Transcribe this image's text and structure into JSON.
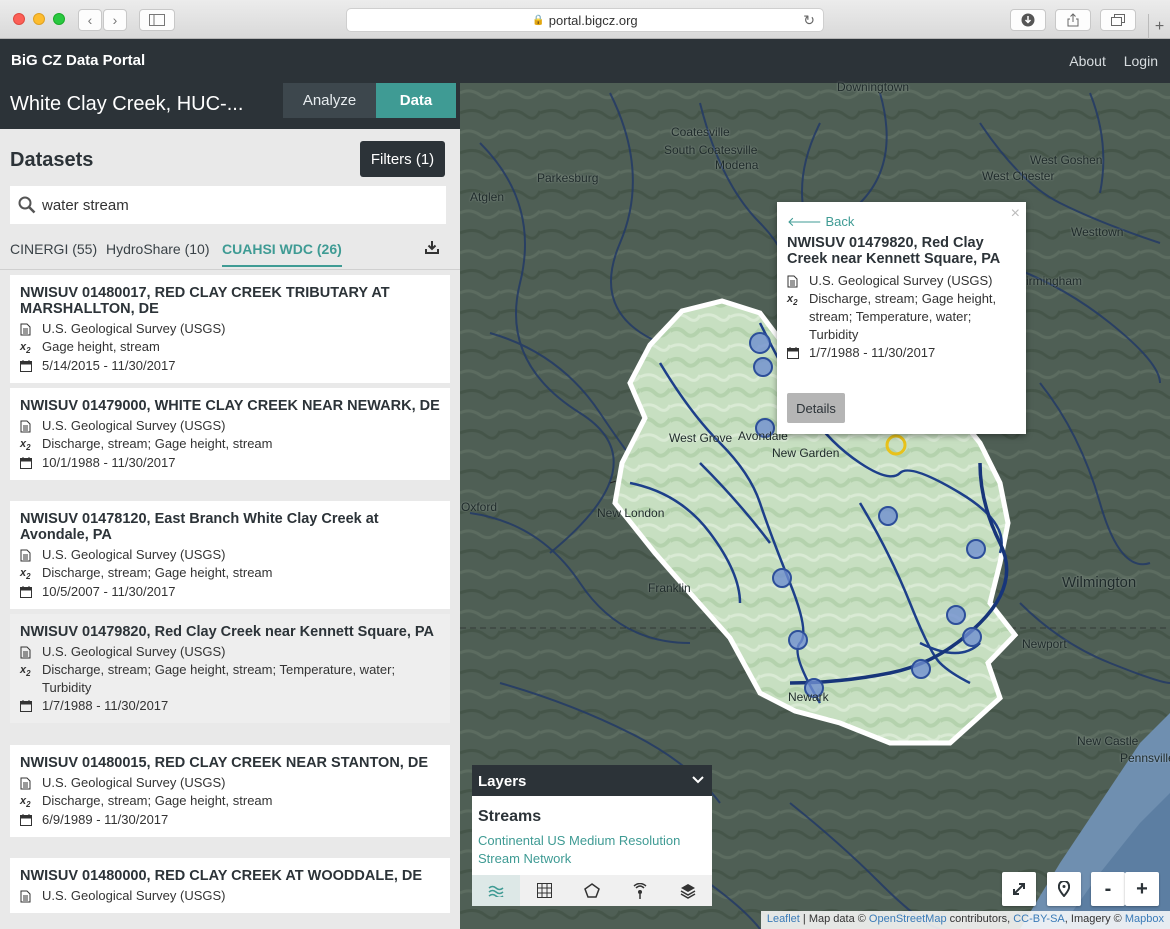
{
  "browser": {
    "url": "portal.bigcz.org"
  },
  "app": {
    "brand": "BiG CZ Data Portal",
    "nav": [
      "About",
      "Login"
    ]
  },
  "sidebar": {
    "area_title": "White Clay Creek, HUC-...",
    "tabs": {
      "analyze": "Analyze",
      "data": "Data"
    },
    "datasets_title": "Datasets",
    "filters_label": "Filters (1)",
    "search_value": "water stream",
    "sources": [
      {
        "label": "CINERGI (55)",
        "active": false
      },
      {
        "label": "HydroShare (10)",
        "active": false
      },
      {
        "label": "CUAHSI WDC (26)",
        "active": true
      }
    ],
    "results": [
      {
        "title": "NWISUV 01480017, RED CLAY CREEK TRIBUTARY AT MARSHALLTON, DE",
        "source": "U.S. Geological Survey (USGS)",
        "variables": "Gage height, stream",
        "dates": "5/14/2015 - 11/30/2017",
        "selected": false
      },
      {
        "title": "NWISUV 01479000, WHITE CLAY CREEK NEAR NEWARK, DE",
        "source": "U.S. Geological Survey (USGS)",
        "variables": "Discharge, stream; Gage height, stream",
        "dates": "10/1/1988 - 11/30/2017",
        "selected": false
      },
      {
        "title": "NWISUV 01478120, East Branch White Clay Creek at Avondale, PA",
        "source": "U.S. Geological Survey (USGS)",
        "variables": "Discharge, stream; Gage height, stream",
        "dates": "10/5/2007 - 11/30/2017",
        "selected": false
      },
      {
        "title": "NWISUV 01479820, Red Clay Creek near Kennett Square, PA",
        "source": "U.S. Geological Survey (USGS)",
        "variables": "Discharge, stream; Gage height, stream; Temperature, water; Turbidity",
        "dates": "1/7/1988 - 11/30/2017",
        "selected": true
      },
      {
        "title": "NWISUV 01480015, RED CLAY CREEK NEAR STANTON, DE",
        "source": "U.S. Geological Survey (USGS)",
        "variables": "Discharge, stream; Gage height, stream",
        "dates": "6/9/1989 - 11/30/2017",
        "selected": false
      },
      {
        "title": "NWISUV 01480000, RED CLAY CREEK AT WOODDALE, DE",
        "source": "U.S. Geological Survey (USGS)",
        "variables": "",
        "dates": "",
        "selected": false
      }
    ]
  },
  "map": {
    "places": [
      {
        "name": "Downingtown",
        "big": false
      },
      {
        "name": "Coatesville",
        "big": false
      },
      {
        "name": "South Coatesville",
        "big": false
      },
      {
        "name": "Modena",
        "big": false
      },
      {
        "name": "Parkesburg",
        "big": false
      },
      {
        "name": "Atglen",
        "big": false
      },
      {
        "name": "West Goshen",
        "big": false
      },
      {
        "name": "West Chester",
        "big": false
      },
      {
        "name": "Westtown",
        "big": false
      },
      {
        "name": "Birmingham",
        "big": false
      },
      {
        "name": "West Grove",
        "big": false
      },
      {
        "name": "Avondale",
        "big": false
      },
      {
        "name": "New Garden",
        "big": false
      },
      {
        "name": "Oxford",
        "big": false
      },
      {
        "name": "New London",
        "big": false
      },
      {
        "name": "Franklin",
        "big": false
      },
      {
        "name": "Wilmington",
        "big": true
      },
      {
        "name": "Newport",
        "big": false
      },
      {
        "name": "Newark",
        "big": false
      },
      {
        "name": "New Castle",
        "big": false
      },
      {
        "name": "Pennsville",
        "big": false
      }
    ],
    "popup": {
      "back_label": "Back",
      "close_label": "×",
      "title": "NWISUV 01479820, Red Clay Creek near Kennett Square, PA",
      "source": "U.S. Geological Survey (USGS)",
      "variables": "Discharge, stream; Gage height, stream; Temperature, water; Turbidity",
      "dates": "1/7/1988 - 11/30/2017",
      "details_label": "Details"
    },
    "layers": {
      "header": "Layers",
      "section": "Streams",
      "active_layer": "Continental US Medium Resolution Stream Network"
    },
    "controls": {
      "zoom_out": "-",
      "zoom_in": "+"
    },
    "attribution": {
      "leaflet": "Leaflet",
      "text1": " | Map data © ",
      "osm": "OpenStreetMap",
      "text2": " contributors, ",
      "license": "CC-BY-SA",
      "text3": ", Imagery © ",
      "mapbox": "Mapbox"
    }
  }
}
